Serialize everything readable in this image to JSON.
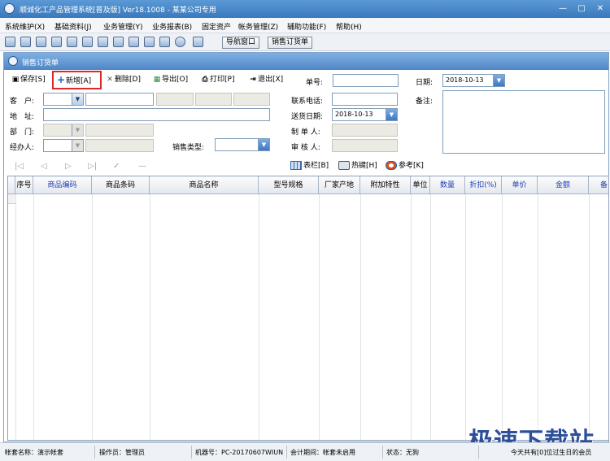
{
  "window": {
    "title": "顺诚化工产品管理系统[普及版] Ver18.1008  -  某某公司专用",
    "controls": [
      "—",
      "□",
      "✕"
    ]
  },
  "menu": [
    "系统维护(X)",
    "基础资料(J)",
    "业务管理(Y)",
    "业务报表(B)",
    "固定资产",
    "帐务管理(Z)",
    "辅助功能(F)",
    "帮助(H)"
  ],
  "toptoolbar": {
    "nav_window": "导航窗口",
    "sales_order": "销售订货单"
  },
  "panel": {
    "title": "销售订货单"
  },
  "actions": {
    "save": "保存[S]",
    "new": "新增[A]",
    "delete": "删除[D]",
    "export": "导出[O]",
    "print": "打印[P]",
    "exit": "退出[X]"
  },
  "header_fields": {
    "order_no_label": "单号:",
    "order_no": "",
    "date_label": "日期:",
    "date": "2018-10-13"
  },
  "form": {
    "customer_label": "客　户:",
    "address_label": "地　址:",
    "dept_label": "部　门:",
    "handler_label": "经办人:",
    "sales_type_label": "销售类型:",
    "phone_label": "联系电话:",
    "delivery_date_label": "送货日期:",
    "delivery_date": "2018-10-13",
    "maker_label": "制 单 人:",
    "auditor_label": "审 核 人:",
    "remark_label": "备注:"
  },
  "nav_arrows": [
    "|◁",
    "◁",
    "▷",
    "▷|",
    "✓",
    "—"
  ],
  "grid_tools": {
    "columns": "表栏[B]",
    "hotkey": "热键[H]",
    "reference": "参考[K]"
  },
  "table": {
    "columns": [
      "序号",
      "商品编码",
      "商品条码",
      "商品名称",
      "型号规格",
      "厂家产地",
      "附加特性",
      "单位",
      "数量",
      "折扣(%)",
      "单价",
      "金额",
      "备"
    ],
    "blue_columns": [
      "商品编码",
      "数量",
      "折扣(%)",
      "单价",
      "金额",
      "备"
    ]
  },
  "statusbar": {
    "account": "帐套名称：演示帐套",
    "operator": "操作员：管理员",
    "machine": "机器号：PC-20170607WIUN",
    "period": "会计期间：帐套未启用",
    "state": "状态：无狗",
    "birthday": "今天共有[0]位过生日的会员"
  },
  "watermark": "极速下载站",
  "colors": {
    "titlebar": "#3a78bd",
    "highlight": "#e0282a",
    "blue_text": "#1f3fae"
  }
}
